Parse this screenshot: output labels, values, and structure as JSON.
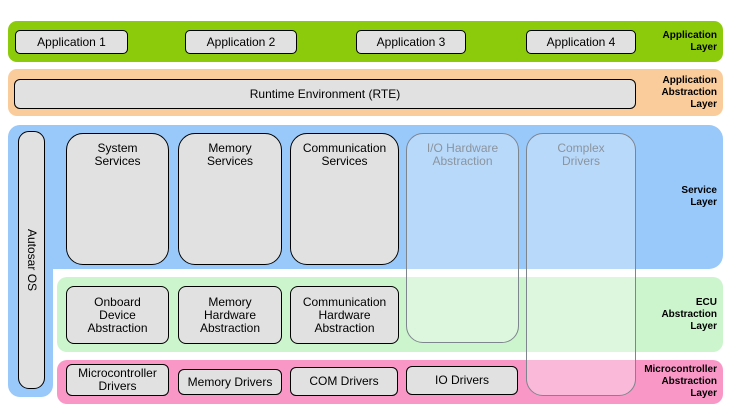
{
  "application_layer": {
    "label": "Application\nLayer",
    "applications": [
      "Application 1",
      "Application 2",
      "Application 3",
      "Application 4"
    ]
  },
  "application_abstraction_layer": {
    "label": "Application\nAbstraction\nLayer",
    "rte_box": "Runtime Environment (RTE)"
  },
  "service_layer": {
    "label": "Service\nLayer",
    "autosar_os": "Autosar OS",
    "services": [
      "System\nServices",
      "Memory\nServices",
      "Communication\nServices"
    ]
  },
  "cross_layer_boxes": {
    "io_hardware_abstraction": "I/O Hardware\nAbstraction",
    "complex_drivers": "Complex\nDrivers"
  },
  "ecu_abstraction_layer": {
    "label": "ECU\nAbstraction\nLayer",
    "modules": [
      "Onboard\nDevice\nAbstraction",
      "Memory\nHardware\nAbstraction",
      "Communication\nHardware\nAbstraction"
    ]
  },
  "microcontroller_abstraction_layer": {
    "label": "Microcontroller\nAbstraction\nLayer",
    "drivers": [
      "Microcontroller\nDrivers",
      "Memory Drivers",
      "COM Drivers",
      "IO Drivers"
    ]
  },
  "colors": {
    "application_green": "#8CCA0C",
    "abstraction_orange": "#FACC9C",
    "service_blue": "#99C8FA",
    "ecu_green": "#CCF4CD",
    "mcal_pink": "#F998C7",
    "box_gray": "#E1E1E1",
    "faded_box_text": "#8B949D"
  }
}
